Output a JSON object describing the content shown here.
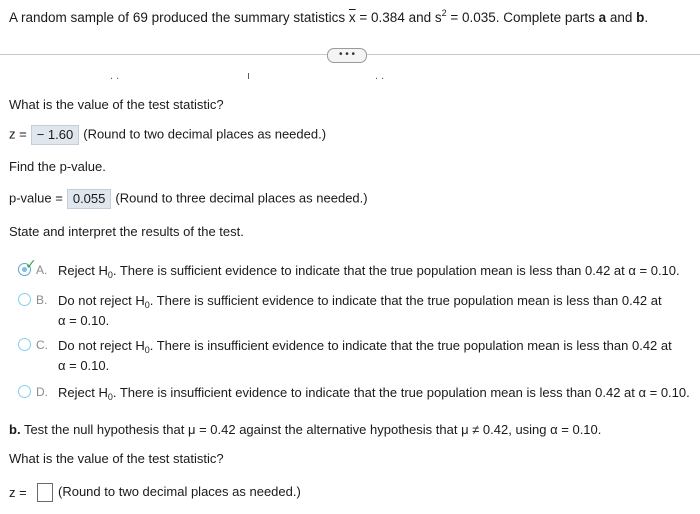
{
  "header": {
    "prefix": "A random sample of 69 produced the summary statistics ",
    "xbar_symbol": "x",
    "eq1": " = 0.384 and s",
    "s_exponent": "2",
    "eq2": " = 0.035. Complete parts ",
    "part_a": "a",
    "and_word": " and ",
    "part_b": "b",
    "end": "."
  },
  "more_button": "• • •",
  "part_a": {
    "question_test_stat": "What is the value of the test statistic?",
    "z_label": "z =",
    "z_value": "− 1.60",
    "z_hint": "(Round to two decimal places as needed.)",
    "find_p": "Find the p-value.",
    "p_label": "p-value =",
    "p_value": "0.055",
    "p_hint": "(Round to three decimal places as needed.)",
    "state": "State and interpret the results of the test.",
    "options": [
      {
        "letter": "A.",
        "line1_a": "Reject H",
        "sub": "0",
        "line1_b": ". There is sufficient evidence to indicate that the true population mean is less than 0.42 at α = 0.10.",
        "line2": "",
        "selected": true
      },
      {
        "letter": "B.",
        "line1_a": "Do not reject H",
        "sub": "0",
        "line1_b": ". There is sufficient evidence to indicate that the true population mean is less than 0.42 at",
        "line2": "α = 0.10.",
        "selected": false
      },
      {
        "letter": "C.",
        "line1_a": "Do not reject H",
        "sub": "0",
        "line1_b": ". There is insufficient evidence to indicate that the true population mean is less than 0.42 at",
        "line2": "α = 0.10.",
        "selected": false
      },
      {
        "letter": "D.",
        "line1_a": "Reject H",
        "sub": "0",
        "line1_b": ". There is insufficient evidence to indicate that the true population mean is less than 0.42 at α = 0.10.",
        "line2": "",
        "selected": false
      }
    ]
  },
  "part_b": {
    "label": "b.",
    "text": " Test the null hypothesis that μ = 0.42 against the alternative hypothesis that μ ≠ 0.42, using α = 0.10.",
    "question_test_stat": "What is the value of the test statistic?",
    "z_label": "z =",
    "z_hint": "(Round to two decimal places as needed.)"
  }
}
